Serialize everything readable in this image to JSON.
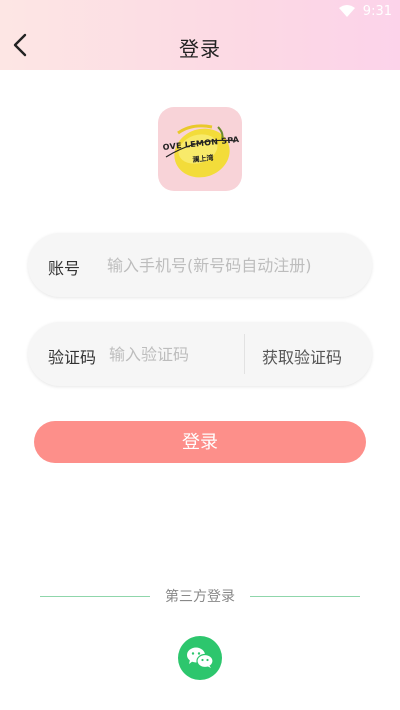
{
  "status_bar": {
    "time": "9:31"
  },
  "header": {
    "title": "登录"
  },
  "logo": {
    "brand_text": "OVE LEMON SPA",
    "sub_text": "澜上湾"
  },
  "account_field": {
    "label": "账号",
    "placeholder": "输入手机号(新号码自动注册)"
  },
  "code_field": {
    "label": "验证码",
    "placeholder": "输入验证码",
    "get_code_label": "获取验证码"
  },
  "login_button": {
    "label": "登录"
  },
  "third_party": {
    "label": "第三方登录",
    "icon": "wechat-icon"
  },
  "colors": {
    "accent": "#fd8f8a",
    "wechat": "#2dc66d",
    "line": "#8fd6ab"
  }
}
